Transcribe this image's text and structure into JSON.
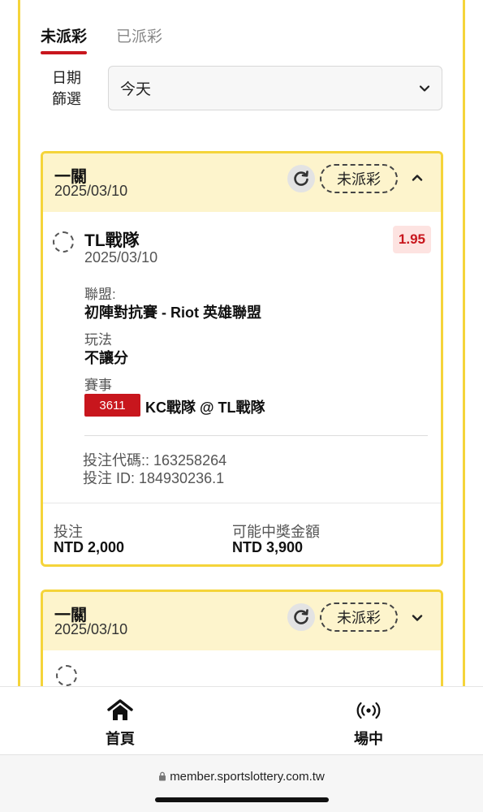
{
  "tabs": [
    {
      "label": "未派彩",
      "active": true
    },
    {
      "label": "已派彩",
      "active": false
    }
  ],
  "date_filter": {
    "label": "日期篩選",
    "label_line1": "日期",
    "label_line2": "篩選",
    "selected": "今天"
  },
  "cards": [
    {
      "title": "一關",
      "date": "2025/03/10",
      "status": "未派彩",
      "expanded": true,
      "bet": {
        "team": "TL戰隊",
        "date": "2025/03/10",
        "odds": "1.95",
        "league_label": "聯盟:",
        "league": "初陣對抗賽 - Riot 英雄聯盟",
        "play_label": "玩法",
        "play": "不讓分",
        "match_label": "賽事",
        "match_id": "3611",
        "match": "KC戰隊 @ TL戰隊",
        "bet_code": "投注代碼:: 163258264",
        "bet_id": "投注 ID: 184930236.1"
      },
      "stake_label": "投注",
      "stake": "NTD 2,000",
      "payout_label": "可能中獎金額",
      "payout": "NTD 3,900"
    },
    {
      "title": "一關",
      "date": "2025/03/10",
      "status": "未派彩",
      "expanded": false
    }
  ],
  "bottom_nav": [
    {
      "label": "首頁",
      "icon": "home-icon"
    },
    {
      "label": "場中",
      "icon": "live-broadcast-icon"
    }
  ],
  "browser": {
    "url": "member.sportslottery.com.tw",
    "lock_icon": "lock-icon"
  },
  "colors": {
    "accent_yellow": "#f5d43a",
    "header_bg": "#fdf4cc",
    "brand_red": "#c8161d"
  }
}
